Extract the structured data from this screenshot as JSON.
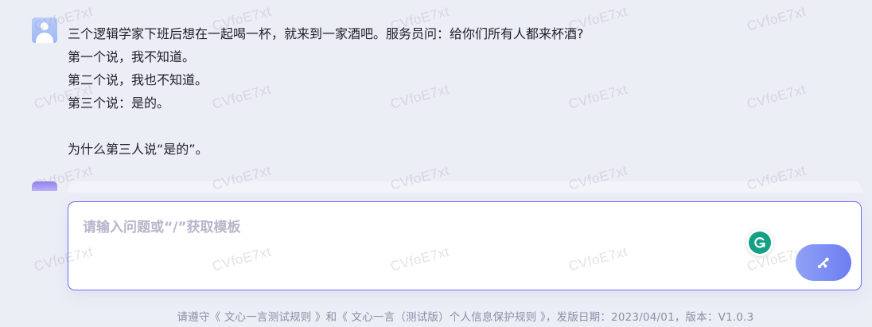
{
  "conversation": {
    "user_message": {
      "lines": [
        "三个逻辑学家下班后想在一起喝一杯，就来到一家酒吧。服务员问：给你们所有人都来杯酒?",
        "第一个说，我不知道。",
        "第二个说，我也不知道。",
        "第三个说：是的。",
        "",
        "为什么第三人说“是的”。"
      ]
    }
  },
  "input": {
    "placeholder": "请输入问题或“/”获取模板",
    "value": ""
  },
  "footer": {
    "text": "请遵守《 文心一言测试规则 》和《 文心一言（测试版）个人信息保护规则 》，发版日期：2023/04/01，版本：V1.0.3"
  },
  "watermark": {
    "text": "CVfoE7xt"
  },
  "colors": {
    "page_background": "#eceef6",
    "accent": "#6b6ff0",
    "send_button_start": "#8fa2f6",
    "send_button_end": "#6c7df2",
    "grammarly": "#15a085"
  },
  "icons": {
    "user_avatar": "user-avatar-icon",
    "bot_avatar": "bot-avatar-icon",
    "grammarly": "grammarly-icon",
    "send": "send-icon"
  }
}
